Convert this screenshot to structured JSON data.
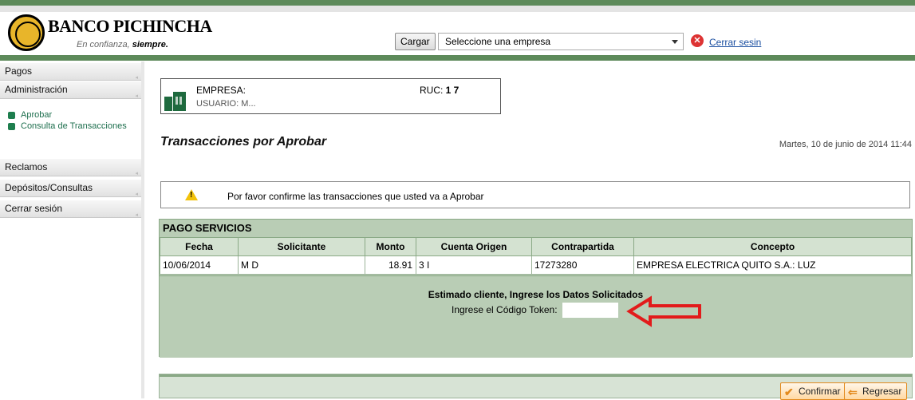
{
  "header": {
    "brand_name": "BANCO PICHINCHA",
    "tagline_prefix": "En confianza, ",
    "tagline_bold": "siempre.",
    "load_button": "Cargar",
    "company_select_value": "Seleccione una empresa",
    "logout_link": "Cerrar sesin"
  },
  "sidebar": {
    "items": [
      {
        "label": "Pagos"
      },
      {
        "label": "Administración"
      },
      {
        "label": "Reclamos"
      },
      {
        "label": "Depósitos/Consultas"
      },
      {
        "label": "Cerrar sesión"
      }
    ],
    "submenu": [
      {
        "label": "Aprobar"
      },
      {
        "label": "Consulta de Transacciones"
      }
    ]
  },
  "company": {
    "empresa_label": "EMPRESA: ",
    "usuario_label": "USUARIO: M...",
    "ruc_label": "RUC: ",
    "ruc_value": "1          7"
  },
  "page": {
    "title": "Transacciones por Aprobar",
    "date": "Martes, 10 de junio de 2014 11:44"
  },
  "notice": {
    "text": "Por favor confirme las transacciones que usted va a Aprobar"
  },
  "services": {
    "title": "PAGO SERVICIOS",
    "columns": [
      "Fecha",
      "Solicitante",
      "Monto",
      "Cuenta Origen",
      "Contrapartida",
      "Concepto"
    ],
    "rows": [
      [
        "10/06/2014",
        "M                    D",
        "18.91",
        "3                 I",
        "17273280",
        "EMPRESA ELECTRICA QUITO S.A.: LUZ"
      ]
    ]
  },
  "token": {
    "title": "Estimado cliente, Ingrese los Datos Solicitados",
    "label": "Ingrese el Código Token:",
    "value": ""
  },
  "actions": {
    "confirm": "Confirmar",
    "back": "Regresar"
  }
}
